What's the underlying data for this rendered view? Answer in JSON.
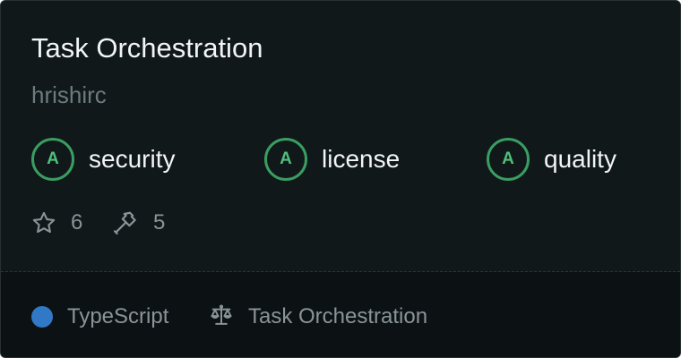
{
  "card": {
    "title": "Task Orchestration",
    "author": "hrishirc"
  },
  "badges": [
    {
      "grade": "A",
      "label": "security"
    },
    {
      "grade": "A",
      "label": "license"
    },
    {
      "grade": "A",
      "label": "quality"
    }
  ],
  "stats": {
    "stars": "6",
    "forks": "5",
    "star_icon": "star-icon",
    "fork_icon": "hammer-icon"
  },
  "footer": {
    "language": "TypeScript",
    "language_color": "#3178c6",
    "license_icon": "scale-icon",
    "license": "Task Orchestration"
  },
  "colors": {
    "background": "#101819",
    "footer_background": "#0c1213",
    "grade_accent": "#3a9d62"
  }
}
